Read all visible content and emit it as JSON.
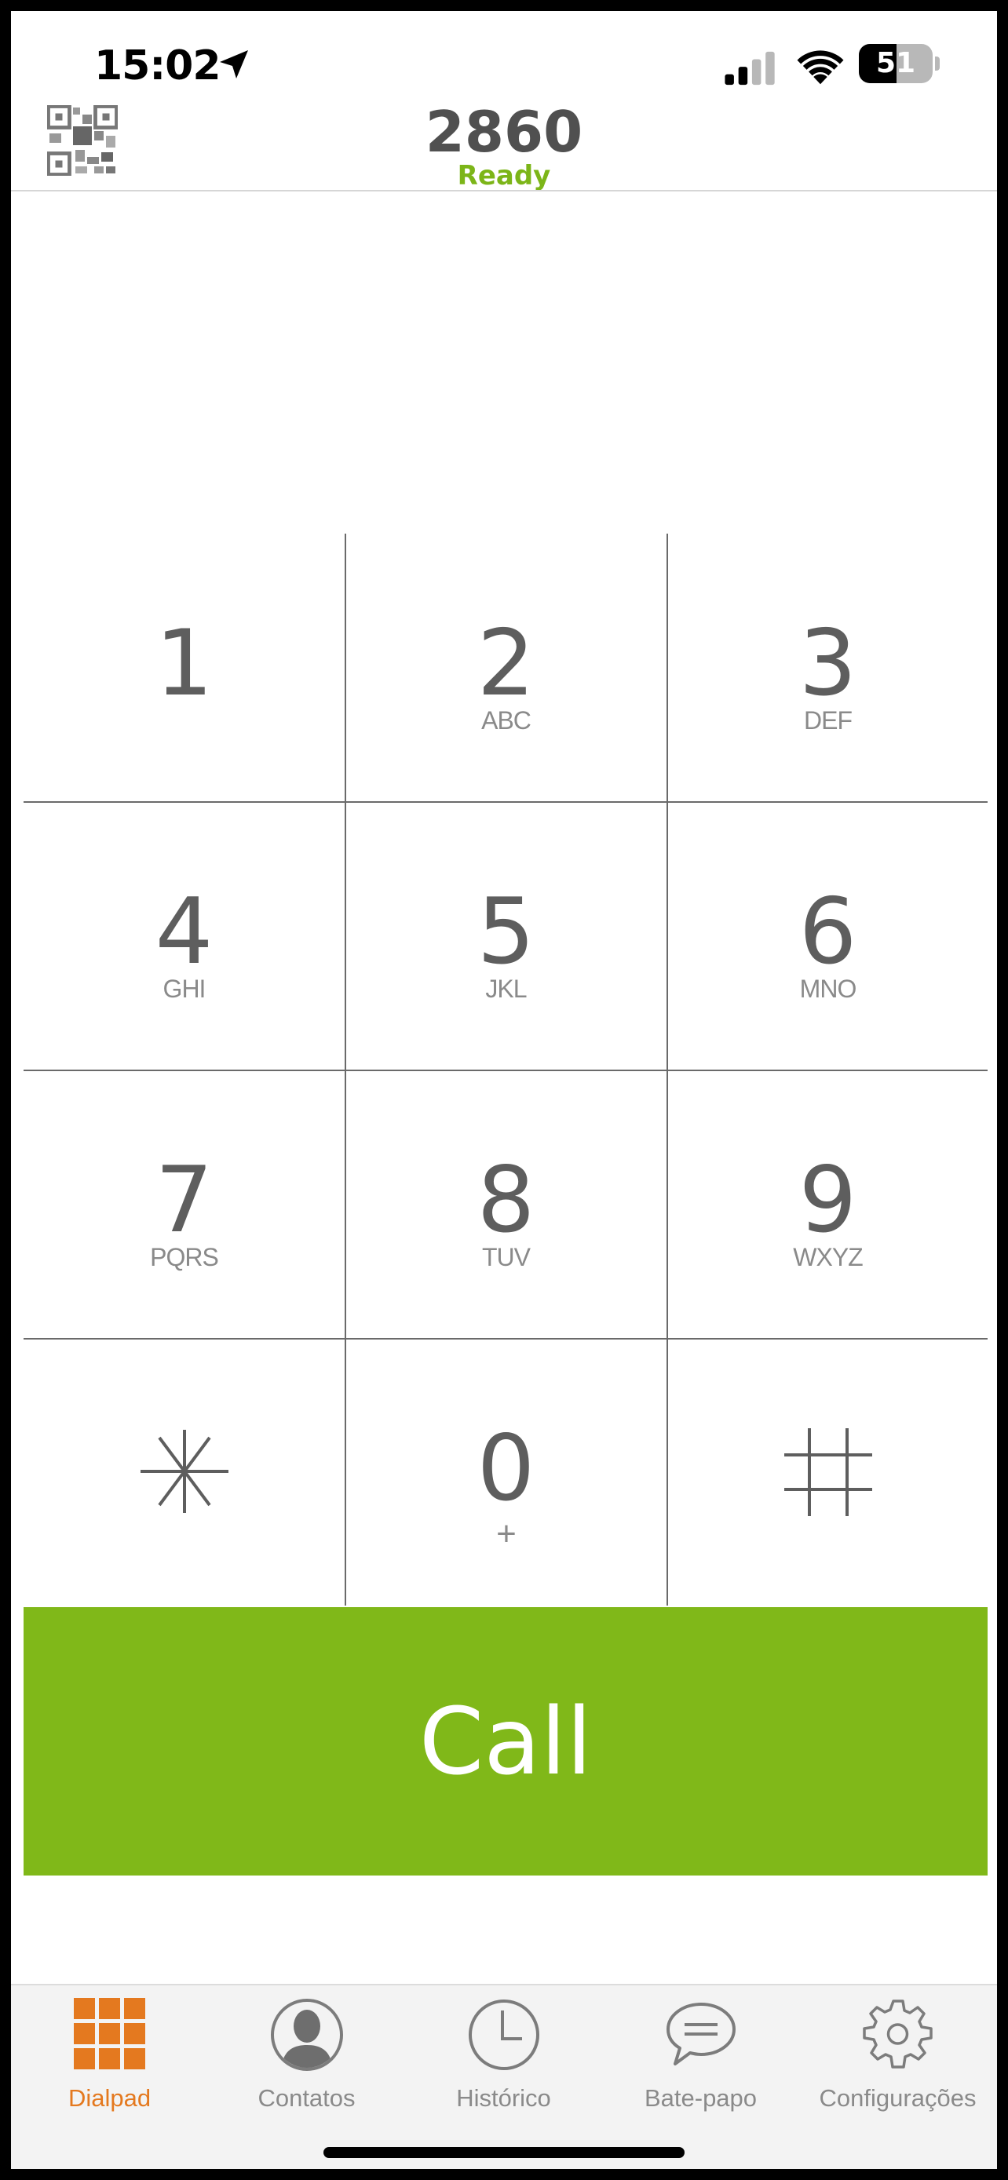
{
  "status_bar": {
    "time": "15:02",
    "battery": "51",
    "battery_level": 0.51,
    "icons": [
      "location-arrow-icon",
      "signal-icon",
      "wifi-icon",
      "battery-icon"
    ]
  },
  "header": {
    "extension": "2860",
    "status": "Ready",
    "status_color": "#7cb518",
    "qr_icon": "qr-code-icon"
  },
  "keypad": {
    "keys": [
      {
        "digit": "1",
        "letters": ""
      },
      {
        "digit": "2",
        "letters": "ABC"
      },
      {
        "digit": "3",
        "letters": "DEF"
      },
      {
        "digit": "4",
        "letters": "GHI"
      },
      {
        "digit": "5",
        "letters": "JKL"
      },
      {
        "digit": "6",
        "letters": "MNO"
      },
      {
        "digit": "7",
        "letters": "PQRS"
      },
      {
        "digit": "8",
        "letters": "TUV"
      },
      {
        "digit": "9",
        "letters": "WXYZ"
      },
      {
        "digit": "*",
        "letters": ""
      },
      {
        "digit": "0",
        "letters": "+"
      },
      {
        "digit": "#",
        "letters": ""
      }
    ]
  },
  "call_button": {
    "label": "Call",
    "color": "#80b819"
  },
  "tabbar": {
    "active_color": "#e4791f",
    "tabs": [
      {
        "label": "Dialpad",
        "icon": "dialpad-grid-icon",
        "active": true
      },
      {
        "label": "Contatos",
        "icon": "contact-person-icon",
        "active": false
      },
      {
        "label": "Histórico",
        "icon": "clock-icon",
        "active": false
      },
      {
        "label": "Bate-papo",
        "icon": "chat-bubble-icon",
        "active": false
      },
      {
        "label": "Configurações",
        "icon": "gear-icon",
        "active": false
      }
    ]
  }
}
